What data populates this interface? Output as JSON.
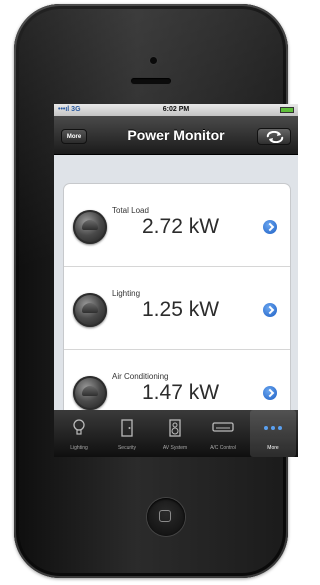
{
  "status_bar": {
    "carrier": "•••ıl 3G",
    "time": "6:02 PM"
  },
  "nav": {
    "back_label": "More",
    "title": "Power Monitor"
  },
  "rows": [
    {
      "label": "Total Load",
      "value": "2.72 kW"
    },
    {
      "label": "Lighting",
      "value": "1.25 kW"
    },
    {
      "label": "Air Conditioning",
      "value": "1.47 kW"
    }
  ],
  "tabs": [
    {
      "label": "Lighting",
      "icon": "lightbulb-icon"
    },
    {
      "label": "Security",
      "icon": "door-icon"
    },
    {
      "label": "AV System",
      "icon": "speaker-icon"
    },
    {
      "label": "A/C Control",
      "icon": "air-conditioner-icon"
    },
    {
      "label": "More",
      "icon": "more-dots-icon"
    }
  ],
  "colors": {
    "accent": "#1d5fc4",
    "nav_bg": "#2a2a2a",
    "battery": "#5fbf3a"
  }
}
